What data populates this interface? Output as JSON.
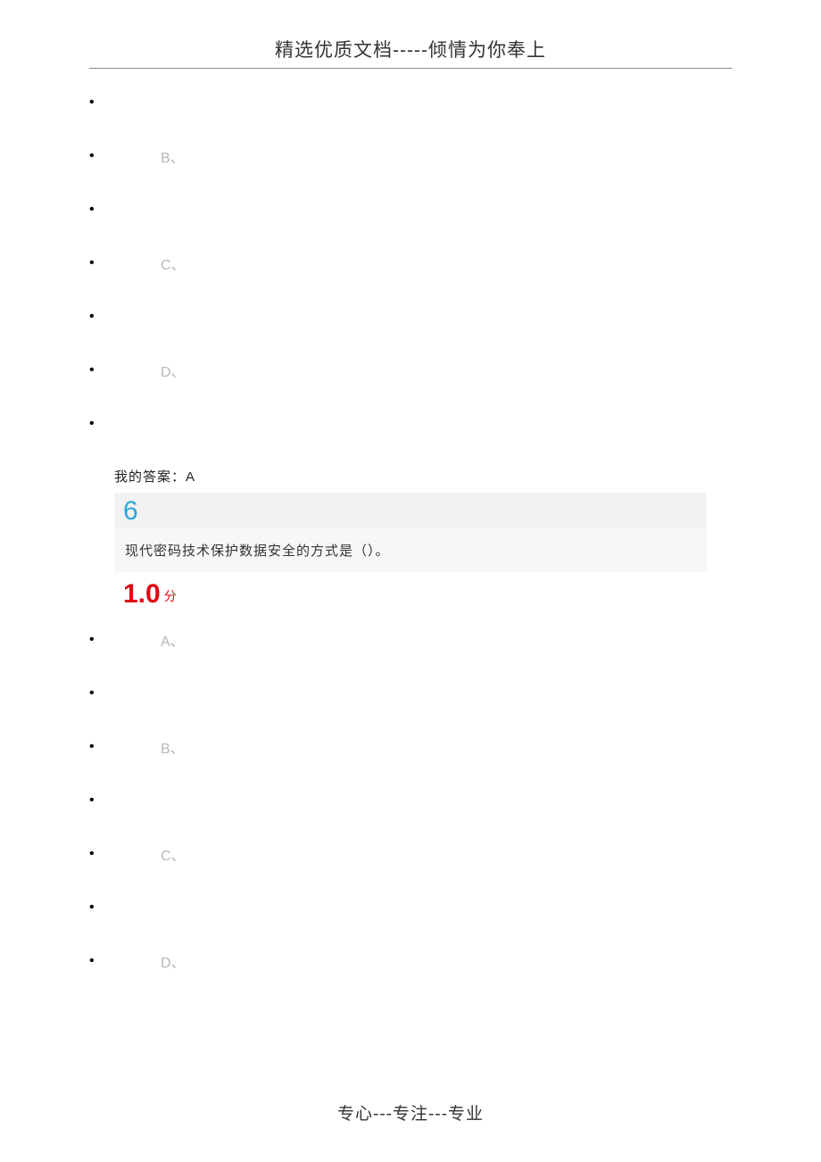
{
  "header": {
    "title": "精选优质文档-----倾情为你奉上"
  },
  "q5_tail": {
    "options": {
      "b": "B、",
      "c": "C、",
      "d": "D、"
    },
    "answer_label": "我的答案：",
    "answer_value": "A"
  },
  "q6": {
    "number": "6",
    "text": "现代密码技术保护数据安全的方式是（）。",
    "score_value": "1.0",
    "score_suffix": "分",
    "options": {
      "a": "A、",
      "b": "B、",
      "c": "C、",
      "d": "D、"
    }
  },
  "footer": {
    "text": "专心---专注---专业"
  }
}
